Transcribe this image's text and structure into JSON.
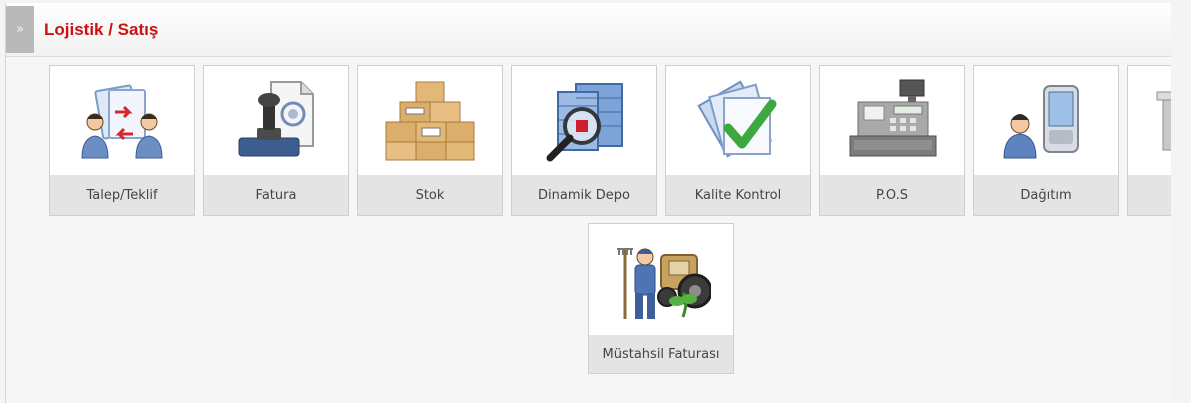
{
  "header": {
    "expand_glyph": "»",
    "title": "Lojistik / Satış"
  },
  "tiles": [
    {
      "label": "Talep/Teklif",
      "icon": "people-exchange-icon"
    },
    {
      "label": "Fatura",
      "icon": "stamp-invoice-icon"
    },
    {
      "label": "Stok",
      "icon": "boxes-icon"
    },
    {
      "label": "Dinamik Depo",
      "icon": "magnifier-warehouse-icon"
    },
    {
      "label": "Kalite Kontrol",
      "icon": "checkmark-document-icon"
    },
    {
      "label": "P.O.S",
      "icon": "cash-register-icon"
    },
    {
      "label": "Dağıtım",
      "icon": "person-pda-icon"
    },
    {
      "label": "",
      "icon": "partial-tile-icon"
    },
    {
      "label": "Müstahsil Faturası",
      "icon": "farmer-tractor-icon"
    }
  ]
}
